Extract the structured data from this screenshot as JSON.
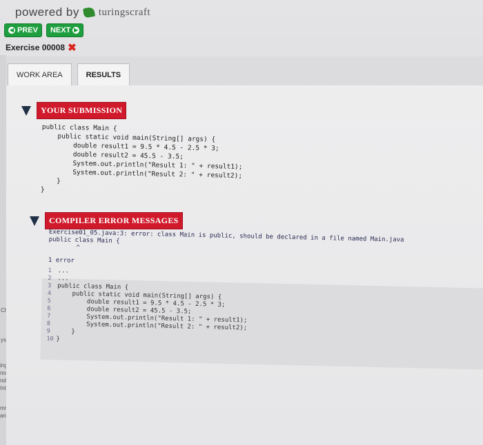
{
  "header": {
    "powered_by": "powered by",
    "brand": "turingscraft"
  },
  "nav": {
    "prev_label": "PREV",
    "next_label": "NEXT"
  },
  "exercise": {
    "title": "Exercise 00008",
    "status_icon": "x-mark-icon",
    "status_color": "#d9261c"
  },
  "tabs": [
    {
      "label": "WORK AREA"
    },
    {
      "label": "RESULTS"
    }
  ],
  "submission": {
    "label": "YOUR SUBMISSION",
    "code": "public class Main {\n    public static void main(String[] args) {\n        double result1 = 9.5 * 4.5 - 2.5 * 3;\n        double result2 = 45.5 - 3.5;\n        System.out.println(\"Result 1: \" + result1);\n        System.out.println(\"Result 2: \" + result2);\n    }\n}"
  },
  "compiler": {
    "label": "COMPILER ERROR MESSAGES",
    "error_line": "Exercise01_05.java:3: error: class Main is public, should be declared in a file named Main.java",
    "error_context": "public class Main {",
    "caret": "^",
    "error_count": "1 error",
    "listing": [
      {
        "n": "1",
        "text": "..."
      },
      {
        "n": "2",
        "text": "..."
      },
      {
        "n": "3",
        "text": "public class Main {"
      },
      {
        "n": "4",
        "text": "    public static void main(String[] args) {"
      },
      {
        "n": "5",
        "text": "        double result1 = 9.5 * 4.5 - 2.5 * 3;"
      },
      {
        "n": "6",
        "text": "        double result2 = 45.5 - 3.5;"
      },
      {
        "n": "7",
        "text": "        System.out.println(\"Result 1: \" + result1);"
      },
      {
        "n": "8",
        "text": "        System.out.println(\"Result 2: \" + result2);"
      },
      {
        "n": "9",
        "text": "    }"
      },
      {
        "n": "10",
        "text": "}"
      }
    ]
  },
  "side_fragments": [
    "Ch",
    "ys",
    "ing",
    "norph",
    "nd Te",
    "Inter",
    "mmin",
    "and M"
  ],
  "colors": {
    "nav_green": "#1e9e3e",
    "section_red": "#d0192b",
    "triangle_navy": "#1f2f45"
  }
}
